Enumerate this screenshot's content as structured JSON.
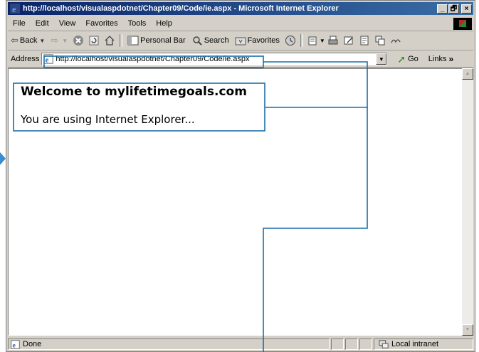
{
  "window": {
    "title": "http://localhost/visualaspdotnet/Chapter09/Code/ie.aspx - Microsoft Internet Explorer",
    "caption_buttons": [
      "_",
      "🗗",
      "×"
    ]
  },
  "menu": [
    "File",
    "Edit",
    "View",
    "Favorites",
    "Tools",
    "Help"
  ],
  "toolbar": {
    "back_label": "Back",
    "personal_bar_label": "Personal Bar",
    "search_label": "Search",
    "favorites_label": "Favorites"
  },
  "address": {
    "label": "Address",
    "url": "http://localhost/visualaspdotnet/Chapter09/Code/ie.aspx",
    "go_label": "Go",
    "links_label": "Links"
  },
  "page": {
    "heading": "Welcome to mylifetimegoals.com",
    "message": "You are using Internet Explorer..."
  },
  "status": {
    "text": "Done",
    "zone": "Local intranet"
  },
  "colors": {
    "titlebar_start": "#0a246a",
    "titlebar_end": "#3a6ea5",
    "chrome": "#d4d0c8",
    "callout": "#1a6fa8"
  }
}
